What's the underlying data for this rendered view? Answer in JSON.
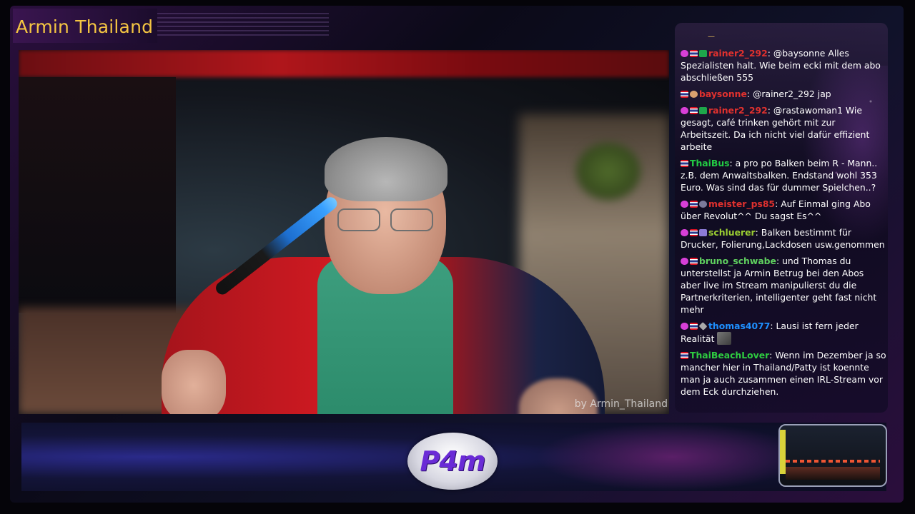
{
  "stream": {
    "title": "Armin Thailand",
    "watermark": "by Armin_Thailand",
    "logo_text": "P4m"
  },
  "chat": {
    "top_mark": "—",
    "messages": [
      {
        "badges": [
          "heart",
          "flag",
          "green"
        ],
        "user": "rainer2_292",
        "user_color": "#e0312e",
        "text": "@baysonne Alles Spezialisten halt. Wie beim ecki mit dem abo abschließen 555"
      },
      {
        "badges": [
          "flag",
          "face"
        ],
        "user": "baysonne",
        "user_color": "#e0312e",
        "text": "@rainer2_292 jap"
      },
      {
        "badges": [
          "heart",
          "flag",
          "green"
        ],
        "user": "rainer2_292",
        "user_color": "#e0312e",
        "text": "@rastawoman1 Wie gesagt, café trinken gehört mit zur Arbeitszeit. Da ich nicht viel dafür effizient arbeite"
      },
      {
        "badges": [
          "flag"
        ],
        "user": "ThaiBus",
        "user_color": "#22cc44",
        "text": "a pro po Balken beim R - Mann.. z.B. dem Anwaltsbalken. Endstand wohl 353 Euro. Was sind das für dummer Spielchen..?"
      },
      {
        "badges": [
          "heart",
          "flag",
          "gear"
        ],
        "user": "meister_ps85",
        "user_color": "#e0312e",
        "text": "Auf Einmal ging Abo über Revolut^^ Du sagst Es^^"
      },
      {
        "badges": [
          "heart",
          "flag",
          "bits"
        ],
        "user": "schluerer",
        "user_color": "#9acd32",
        "text": "Balken bestimmt für Drucker, Folierung,Lackdosen usw.genommen"
      },
      {
        "badges": [
          "heart",
          "flag"
        ],
        "user": "bruno_schwabe",
        "user_color": "#5fcf5f",
        "text": "und Thomas du unterstellst ja Armin Betrug bei den Abos aber live im Stream manipulierst du die Partnerkriterien, intelligenter geht fast nicht mehr"
      },
      {
        "badges": [
          "heart",
          "flag",
          "gem"
        ],
        "user": "thomas4077",
        "user_color": "#1e90ff",
        "text": "Lausi ist fern jeder Realität",
        "emote": true
      },
      {
        "badges": [
          "flag"
        ],
        "user": "ThaiBeachLover",
        "user_color": "#2ecc40",
        "text": "Wenn im Dezember ja so mancher hier in Thailand/Patty ist koennte man ja auch zusammen einen IRL-Stream vor dem Eck durchziehen."
      }
    ]
  }
}
